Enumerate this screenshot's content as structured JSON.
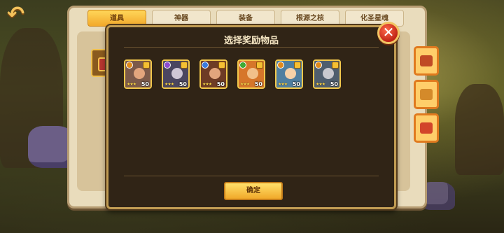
{
  "tabs": [
    "道具",
    "神器",
    "装备",
    "根源之核",
    "化圣星魂"
  ],
  "active_tab": 0,
  "modal": {
    "title": "选择奖励物品",
    "close_icon": "close-icon",
    "confirm_label": "确定"
  },
  "heroes": [
    {
      "element_color": "#e08a1b",
      "portrait_color": "#7c5a4a",
      "stars": "★★★",
      "level": "50"
    },
    {
      "element_color": "#8d4bd0",
      "portrait_color": "#4b4660",
      "stars": "★★★",
      "level": "50"
    },
    {
      "element_color": "#3a7be0",
      "portrait_color": "#6e3b25",
      "stars": "★★★",
      "level": "50"
    },
    {
      "element_color": "#3dab35",
      "portrait_color": "#d6762a",
      "stars": "★★★",
      "level": "50"
    },
    {
      "element_color": "#e08a1b",
      "portrait_color": "#4f7fa0",
      "stars": "★★★",
      "level": "50"
    },
    {
      "element_color": "#e08a1b",
      "portrait_color": "#4f5e6e",
      "stars": "★★★",
      "level": "50"
    }
  ],
  "side_icons": [
    "box-icon",
    "chest-icon",
    "gift-icon"
  ]
}
